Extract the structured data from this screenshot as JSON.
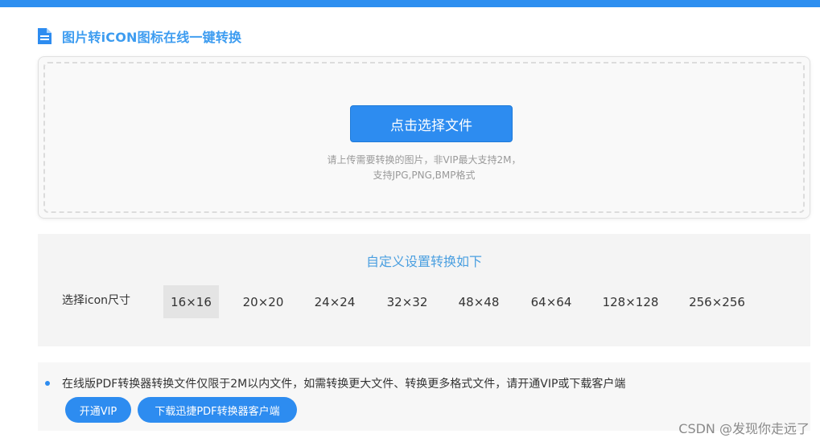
{
  "header": {
    "title": "图片转iCON图标在线一键转换",
    "icon": "document-icon"
  },
  "upload": {
    "button_label": "点击选择文件",
    "hint_line1": "请上传需要转换的图片，非VIP最大支持2M，",
    "hint_line2": "支持JPG,PNG,BMP格式"
  },
  "settings": {
    "title": "自定义设置转换如下",
    "size_label": "选择icon尺寸",
    "sizes": [
      "16×16",
      "20×20",
      "24×24",
      "32×32",
      "48×48",
      "64×64",
      "128×128",
      "256×256"
    ],
    "selected": "16×16"
  },
  "notice": {
    "text": "在线版PDF转换器转换文件仅限于2M以内文件，如需转换更大文件、转换更多格式文件，请开通VIP或下载客户端",
    "vip_button": "开通VIP",
    "download_button": "下载迅捷PDF转换器客户端"
  },
  "watermark": "CSDN @发现你走远了",
  "colors": {
    "accent": "#2d8cf0",
    "title": "#3d9cf0",
    "top_bar": "#2e8ff0"
  }
}
